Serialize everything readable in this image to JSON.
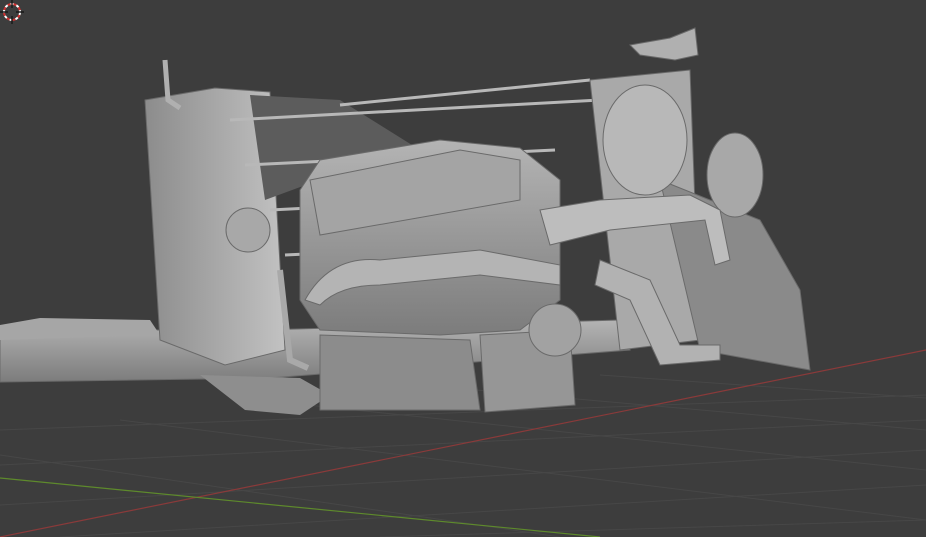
{
  "viewport": {
    "kind": "3D viewport",
    "shading": "solid",
    "background_color": "#3d3d3d",
    "grid_color": "#474747",
    "x_axis_color": "#8a3a3a",
    "y_axis_color": "#5e8a2c",
    "model_color": "#9e9e9e",
    "model_description_icon": "car-engine-chassis-model",
    "cursor_icon": "3d-cursor-icon"
  }
}
